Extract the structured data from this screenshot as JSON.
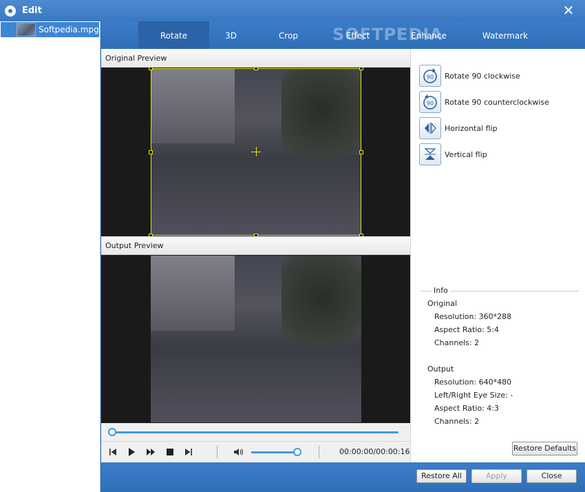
{
  "window": {
    "title": "Edit"
  },
  "sidebar": {
    "files": [
      {
        "name": "Softpedia.mpg"
      }
    ]
  },
  "tabs": [
    "Rotate",
    "3D",
    "Crop",
    "Effect",
    "Enhance",
    "Watermark"
  ],
  "active_tab": "Rotate",
  "watermark_text": "SOFTPEDIA",
  "previews": {
    "original_label": "Original Preview",
    "output_label": "Output Preview"
  },
  "player": {
    "time": "00:00:00/00:00:16",
    "seek_fraction": 0.0,
    "volume_fraction": 0.95
  },
  "rotate_actions": [
    {
      "label": "Rotate 90 clockwise",
      "icon": "rotate-clockwise-icon"
    },
    {
      "label": "Rotate 90 counterclockwise",
      "icon": "rotate-counterclockwise-icon"
    },
    {
      "label": "Horizontal flip",
      "icon": "horizontal-flip-icon"
    },
    {
      "label": "Vertical flip",
      "icon": "vertical-flip-icon"
    }
  ],
  "info": {
    "title": "Info",
    "original": {
      "heading": "Original",
      "resolution": "Resolution: 360*288",
      "aspect_ratio": "Aspect Ratio: 5:4",
      "channels": "Channels: 2"
    },
    "output": {
      "heading": "Output",
      "resolution": "Resolution: 640*480",
      "eye_size": "Left/Right Eye Size: -",
      "aspect_ratio": "Aspect Ratio: 4:3",
      "channels": "Channels: 2"
    }
  },
  "buttons": {
    "restore_defaults": "Restore Defaults",
    "restore_all": "Restore All",
    "apply": "Apply",
    "close": "Close"
  },
  "colors": {
    "titlebar": "#3a78c2",
    "accent": "#3d9ae0",
    "crop_frame": "#e6e600"
  }
}
